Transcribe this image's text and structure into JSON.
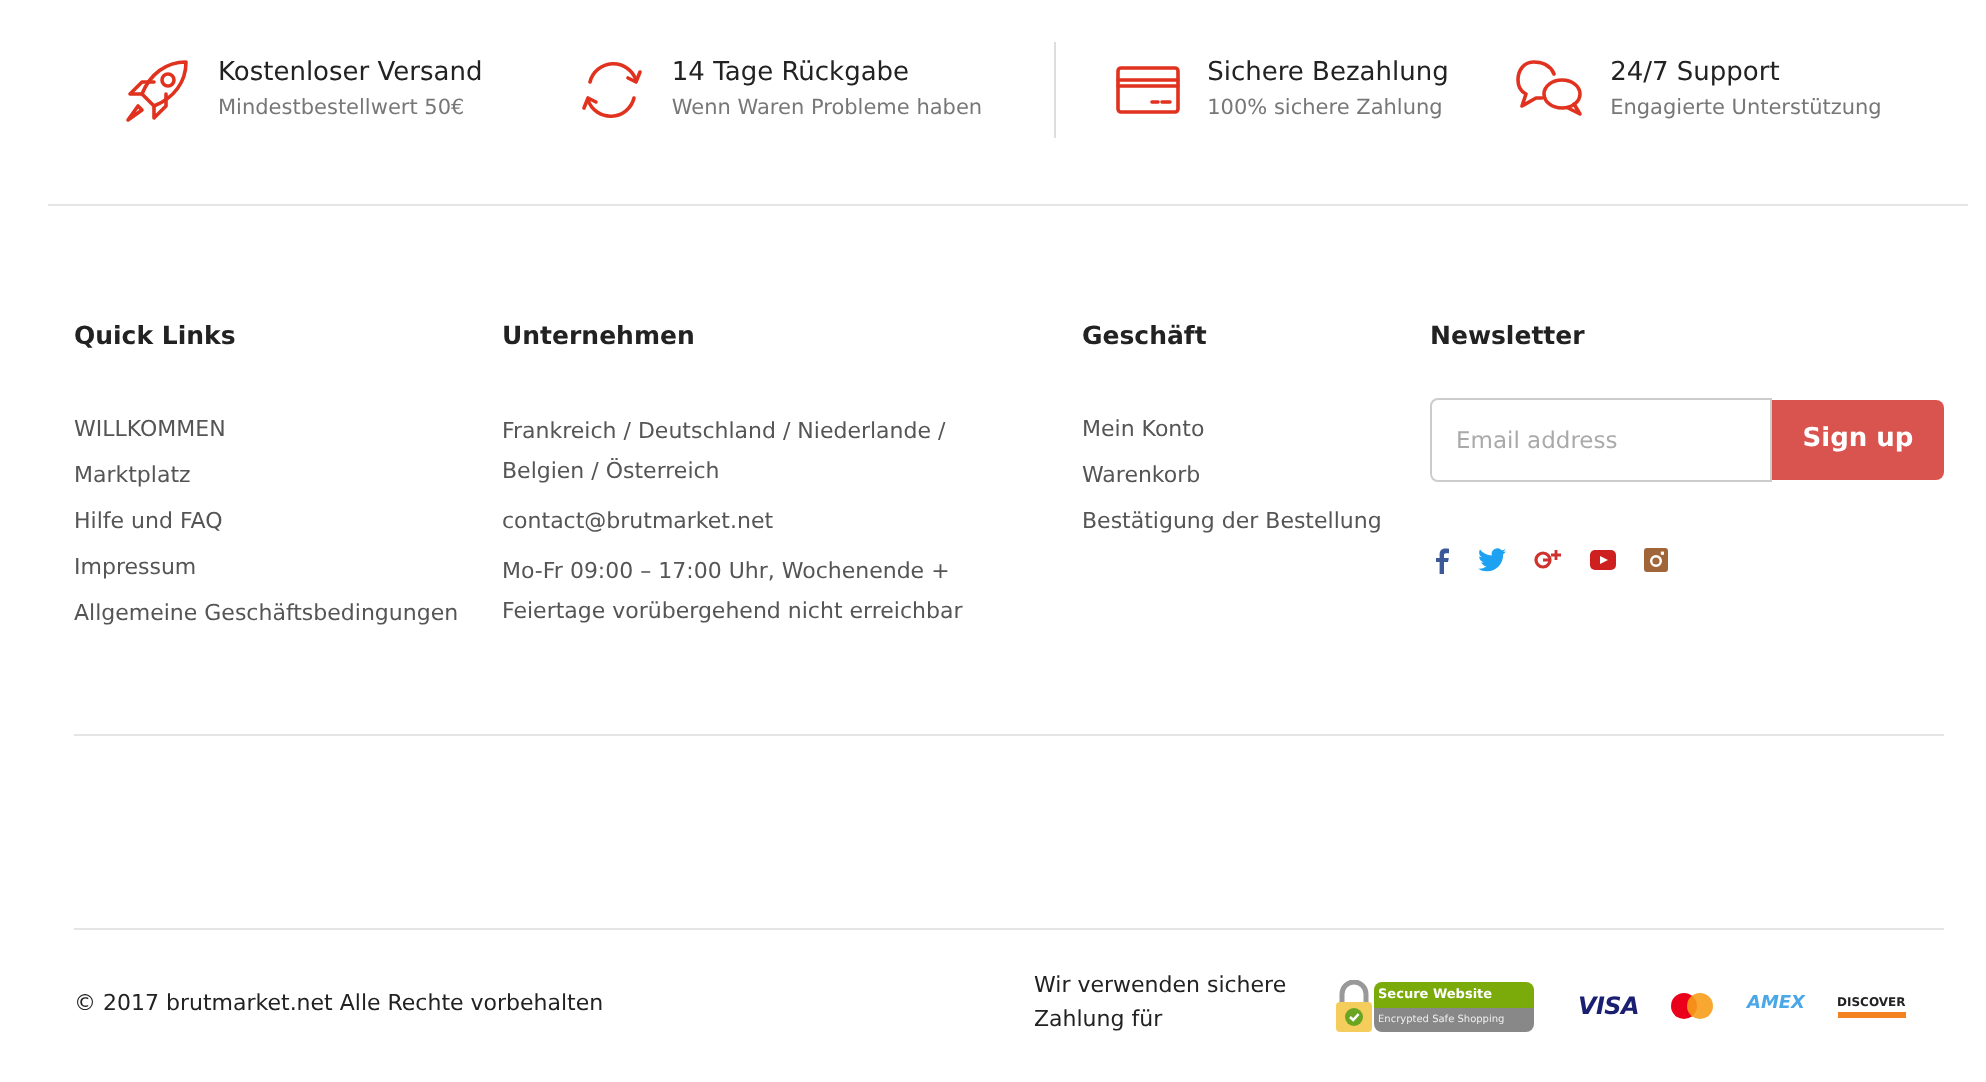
{
  "features": [
    {
      "title": "Kostenloser Versand",
      "subtitle": "Mindestbestellwert 50€"
    },
    {
      "title": "14 Tage Rückgabe",
      "subtitle": "Wenn Waren Probleme haben"
    },
    {
      "title": "Sichere Bezahlung",
      "subtitle": "100% sichere Zahlung"
    },
    {
      "title": "24/7 Support",
      "subtitle": "Engagierte Unterstützung"
    }
  ],
  "columns": [
    {
      "kind": "links",
      "heading": "Quick Links",
      "items": [
        "WILLKOMMEN",
        "Marktplatz",
        "Hilfe und FAQ",
        "Impressum",
        "Allgemeine Geschäftsbedingungen"
      ]
    },
    {
      "kind": "text",
      "heading": "Unternehmen",
      "items": [
        "Frankreich / Deutschland / Niederlande / Belgien / Österreich",
        "contact@brutmarket.net",
        "Mo-Fr 09:00 – 17:00 Uhr, Wochenende + Feiertage vorübergehend nicht erreichbar"
      ]
    },
    {
      "kind": "links",
      "heading": "Geschäft",
      "items": [
        "Mein Konto",
        "Warenkorb",
        "Bestätigung der Bestellung"
      ]
    }
  ],
  "newsletter": {
    "heading": "Newsletter",
    "placeholder": "Email address",
    "button": "Sign up"
  },
  "copyright": "© 2017 brutmarket.net Alle Rechte vorbehalten",
  "payment_note": "Wir verwenden sichere Zahlung für",
  "secure_badge": {
    "title": "Secure Website",
    "subtitle": "Encrypted Safe Shopping"
  },
  "payment_logos": [
    {
      "kind": "visa",
      "label": "VISA"
    },
    {
      "kind": "mastercard"
    },
    {
      "kind": "amex",
      "label": "AMEX"
    },
    {
      "kind": "discover",
      "label": "DISCOVER"
    }
  ]
}
